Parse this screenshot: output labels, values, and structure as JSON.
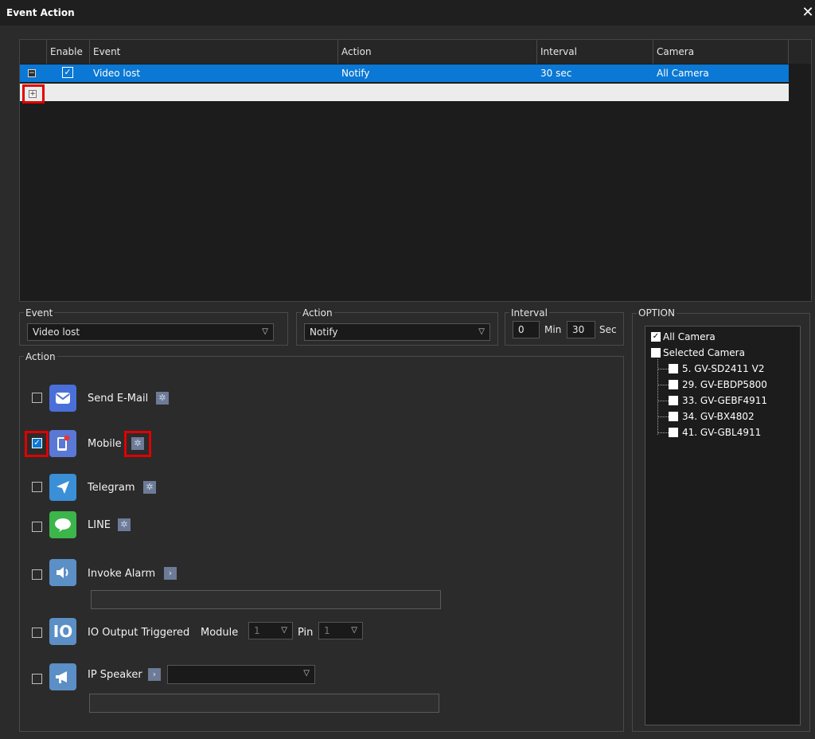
{
  "window": {
    "title": "Event Action",
    "close_glyph": "✕"
  },
  "grid": {
    "headers": [
      "Enable",
      "Event",
      "Action",
      "Interval",
      "Camera"
    ],
    "rows": [
      {
        "enabled": true,
        "event": "Video lost",
        "action": "Notify",
        "interval": "30 sec",
        "camera": "All Camera"
      }
    ]
  },
  "event_group": {
    "label": "Event",
    "value": "Video lost"
  },
  "action_group": {
    "label": "Action",
    "value": "Notify"
  },
  "interval_group": {
    "label": "Interval",
    "min_value": "0",
    "min_label": "Min",
    "sec_value": "30",
    "sec_label": "Sec"
  },
  "actions_group": {
    "label": "Action",
    "items": [
      {
        "label": "Send E-Mail",
        "checked": false,
        "icon": "mail-icon",
        "color": "#4a6fd8"
      },
      {
        "label": "Mobile",
        "checked": true,
        "icon": "mobile-icon",
        "color": "#5a78d6"
      },
      {
        "label": "Telegram",
        "checked": false,
        "icon": "telegram-icon",
        "color": "#3a8fd6"
      },
      {
        "label": "LINE",
        "checked": false,
        "icon": "line-icon",
        "color": "#3cb54a"
      },
      {
        "label": "Invoke Alarm",
        "checked": false,
        "icon": "speaker-icon",
        "color": "#5b8fc6"
      },
      {
        "label": "IO Output Triggered",
        "checked": false,
        "icon": "io-icon",
        "color": "#5b8fc6",
        "icon_text": "IO"
      },
      {
        "label": "IP Speaker",
        "checked": false,
        "icon": "megaphone-icon",
        "color": "#5b8fc6"
      }
    ],
    "io_module_label": "Module",
    "io_module_value": "1",
    "io_pin_label": "Pin",
    "io_pin_value": "1"
  },
  "option": {
    "label": "OPTION",
    "all_camera": {
      "label": "All Camera",
      "checked": true
    },
    "selected_camera": {
      "label": "Selected Camera",
      "checked": false
    },
    "cameras": [
      "5. GV-SD2411 V2",
      "29. GV-EBDP5800",
      "33. GV-GEBF4911",
      "34. GV-BX4802",
      "41. GV-GBL4911"
    ]
  },
  "colors": {
    "selection": "#0a78d4",
    "highlight": "#e00000",
    "background": "#2b2b2b"
  }
}
